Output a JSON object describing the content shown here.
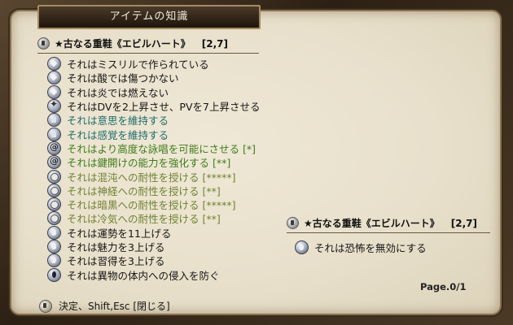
{
  "window": {
    "title": "アイテムの知識"
  },
  "item": {
    "name": "★古なる重鞋《エビルハート》",
    "code": "[2,7]",
    "properties": [
      {
        "icon": "diamond-gem-icon",
        "text": "それはミスリルで作られている",
        "color": "black"
      },
      {
        "icon": "diamond-gem-icon",
        "text": "それは酸では傷つかない",
        "color": "black"
      },
      {
        "icon": "diamond-gem-icon",
        "text": "それは炎では燃えない",
        "color": "black"
      },
      {
        "icon": "star-badge-icon",
        "text": "それはDVを2上昇させ、PVを7上昇させる",
        "color": "black"
      },
      {
        "icon": "cloak-icon",
        "text": "それは意思を維持する",
        "color": "teal"
      },
      {
        "icon": "cloak-icon",
        "text": "それは感覚を維持する",
        "color": "teal"
      },
      {
        "icon": "swirl-icon",
        "text": "それはより高度な詠唱を可能にさせる [*]",
        "color": "green"
      },
      {
        "icon": "swirl-icon",
        "text": "それは鍵開けの能力を強化する [**]",
        "color": "green"
      },
      {
        "icon": "shield-orb-icon",
        "text": "それは混沌への耐性を授ける [*****]",
        "color": "olive"
      },
      {
        "icon": "shield-orb-icon",
        "text": "それは神経への耐性を授ける [**]",
        "color": "olive"
      },
      {
        "icon": "shield-orb-icon",
        "text": "それは暗黒への耐性を授ける [*****]",
        "color": "olive"
      },
      {
        "icon": "shield-orb-icon",
        "text": "それは冷気への耐性を授ける [**]",
        "color": "olive"
      },
      {
        "icon": "foot-icon",
        "text": "それは運勢を11上げる",
        "color": "black"
      },
      {
        "icon": "foot-icon",
        "text": "それは魅力を3上げる",
        "color": "black"
      },
      {
        "icon": "foot-icon",
        "text": "それは習得を3上げる",
        "color": "black"
      },
      {
        "icon": "drop-icon",
        "text": "それは異物の体内への侵入を防ぐ",
        "color": "black"
      }
    ]
  },
  "compare": {
    "name": "★古なる重鞋《エビルハート》",
    "code": "[2,7]",
    "line": {
      "icon": "foot-icon",
      "text": "それは恐怖を無効にする"
    }
  },
  "footer": {
    "page": "Page.0/1",
    "hint": "決定、Shift,Esc [閉じる]"
  },
  "colors": {
    "black": "#151515",
    "teal": "#1f6c6c",
    "green": "#3e7c1a",
    "olive": "#6f8232",
    "parchment": "#e8e0cb",
    "frame": "#2c2014"
  }
}
